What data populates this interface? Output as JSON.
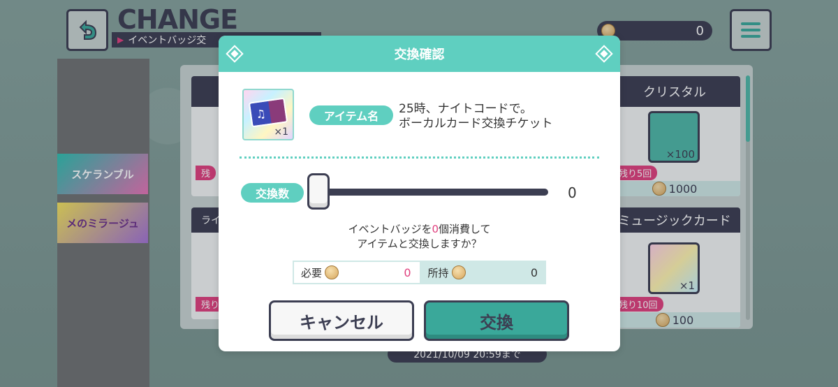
{
  "header": {
    "title": "CHANGE",
    "subtitle": "イベントバッジ交",
    "coin_count": "0"
  },
  "left_banners": [
    {
      "label": "スケランブル"
    },
    {
      "label": "メのミラージュ"
    }
  ],
  "cards": {
    "crystal": {
      "title": "クリスタル",
      "qty": "×100",
      "remain": "残り5回",
      "price": "1000"
    },
    "music_card": {
      "title": "ミュージックカード",
      "qty": "×1",
      "remain": "残り10回",
      "price": "100"
    },
    "left_top_remain": "残",
    "left_bottom_title": "ライ",
    "left_bottom_remain": "残り"
  },
  "deadline": "2021/10/09 20:59まで",
  "modal": {
    "title": "交換確認",
    "item_label": "アイテム名",
    "item_name_line1": "25時、ナイトコードで。",
    "item_name_line2": "ボーカルカード交換チケット",
    "item_qty": "×1",
    "count_label": "交換数",
    "slider_value": "0",
    "confirm_prefix": "イベントバッジを",
    "confirm_count": "0",
    "confirm_suffix": "個消費して",
    "confirm_line2": "アイテムと交換しますか？",
    "need_label": "必要",
    "need_value": "0",
    "have_label": "所持",
    "have_value": "0",
    "cancel_label": "キャンセル",
    "exchange_label": "交換"
  },
  "colors": {
    "accent": "#5fcfc0",
    "dark": "#3c3e52",
    "pink": "#e0407e"
  }
}
